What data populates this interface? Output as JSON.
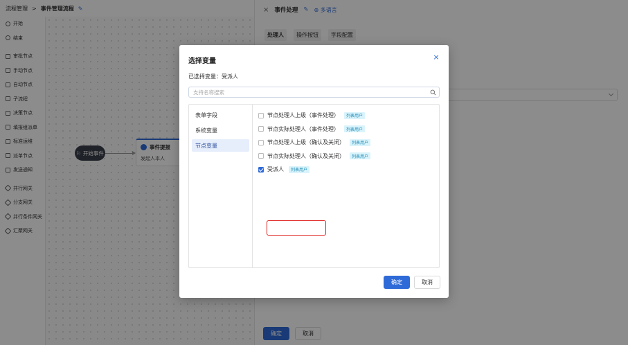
{
  "topbar": {
    "crumb_root": "流程管理",
    "crumb_sep": ">",
    "crumb_current": "事件管理流程",
    "edit_icon": "pencil-icon"
  },
  "sidebar": {
    "items": [
      {
        "label": "开始",
        "icon": "flag-icon"
      },
      {
        "label": "结束",
        "icon": "stop-icon"
      },
      {
        "label": "审批节点",
        "icon": "approve-icon"
      },
      {
        "label": "手动节点",
        "icon": "hand-icon"
      },
      {
        "label": "自动节点",
        "icon": "auto-icon"
      },
      {
        "label": "子流程",
        "icon": "subflow-icon"
      },
      {
        "label": "决策节点",
        "icon": "decision-icon"
      },
      {
        "label": "填报组派单",
        "icon": "dispatch-icon"
      },
      {
        "label": "标准运维",
        "icon": "ops-icon"
      },
      {
        "label": "派单节点",
        "icon": "dispatch-node-icon"
      },
      {
        "label": "发送通知",
        "icon": "notify-icon"
      },
      {
        "label": "并行网关",
        "icon": "gateway-icon"
      },
      {
        "label": "分支网关",
        "icon": "branch-gateway-icon"
      },
      {
        "label": "并行条件网关",
        "icon": "condition-gateway-icon"
      },
      {
        "label": "汇聚网关",
        "icon": "merge-gateway-icon"
      }
    ]
  },
  "canvas": {
    "start_node_label": "开始事件",
    "event_node_title": "事件提报",
    "event_node_sub": "发起人本人"
  },
  "right_panel": {
    "close": "×",
    "title": "事件处理",
    "lang_link": "多语言",
    "tabs": [
      "处理人",
      "操作按钮",
      "字段配置"
    ],
    "confirm": "确定",
    "cancel": "取消"
  },
  "modal": {
    "title": "选择变量",
    "close": "×",
    "selected_prefix": "已选择变量：",
    "selected_value": "受派人",
    "search_placeholder": "支持名称搜索",
    "categories": [
      "表单字段",
      "系统变量",
      "节点变量"
    ],
    "active_category": "节点变量",
    "variables": [
      {
        "label": "节点处理人上级（事件处理）",
        "tag": "列表用户",
        "checked": false
      },
      {
        "label": "节点实际处理人（事件处理）",
        "tag": "列表用户",
        "checked": false
      },
      {
        "label": "节点处理人上级（确认及关闭）",
        "tag": "列表用户",
        "checked": false
      },
      {
        "label": "节点实际处理人（确认及关闭）",
        "tag": "列表用户",
        "checked": false
      },
      {
        "label": "受派人",
        "tag": "列表用户",
        "checked": true
      }
    ],
    "confirm": "确定",
    "cancel": "取消"
  },
  "colors": {
    "primary": "#2f6bd8",
    "highlight_border": "#e02020",
    "tag_bg": "#d9f3fb"
  }
}
